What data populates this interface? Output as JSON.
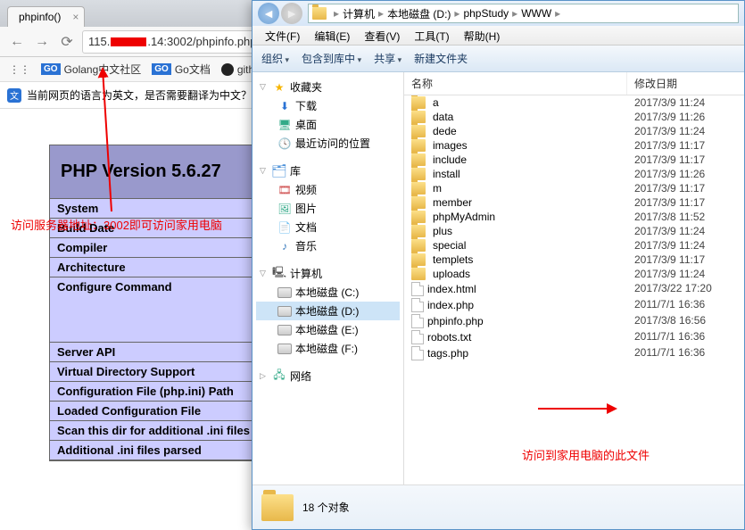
{
  "browser": {
    "tab_title": "phpinfo()",
    "url_pre": "115.",
    "url_post": ".14:3002/phpinfo.php",
    "bookmarks": [
      {
        "badge": "GO",
        "label": "Golang中文社区"
      },
      {
        "badge": "GO",
        "label": "Go文档"
      },
      {
        "icon": "gh",
        "label": "github"
      }
    ],
    "translate_text": "当前网页的语言为英文，是否需要翻译为中文？"
  },
  "php": {
    "title": "PHP Version 5.6.27",
    "rows": [
      "System",
      "Build Date",
      "Compiler",
      "Architecture",
      "Configure Command",
      "Server API",
      "Virtual Directory Support",
      "Configuration File (php.ini) Path",
      "Loaded Configuration File",
      "Scan this dir for additional .ini files",
      "Additional .ini files parsed"
    ]
  },
  "annotation1": "访问服务器地址：3002即可访问家用电脑",
  "annotation2": "访问到家用电脑的此文件",
  "explorer": {
    "breadcrumb": [
      "计算机",
      "本地磁盘 (D:)",
      "phpStudy",
      "WWW"
    ],
    "menus": [
      "文件(F)",
      "编辑(E)",
      "查看(V)",
      "工具(T)",
      "帮助(H)"
    ],
    "toolbar": [
      "组织",
      "包含到库中",
      "共享",
      "新建文件夹"
    ],
    "tree": {
      "fav": {
        "label": "收藏夹",
        "items": [
          "下载",
          "桌面",
          "最近访问的位置"
        ]
      },
      "lib": {
        "label": "库",
        "items": [
          "视频",
          "图片",
          "文档",
          "音乐"
        ]
      },
      "comp": {
        "label": "计算机",
        "items": [
          "本地磁盘 (C:)",
          "本地磁盘 (D:)",
          "本地磁盘 (E:)",
          "本地磁盘 (F:)"
        ]
      },
      "net": {
        "label": "网络"
      }
    },
    "columns": {
      "name": "名称",
      "date": "修改日期"
    },
    "files": [
      {
        "n": "a",
        "t": "folder",
        "d": "2017/3/9 11:24"
      },
      {
        "n": "data",
        "t": "folder",
        "d": "2017/3/9 11:26"
      },
      {
        "n": "dede",
        "t": "folder",
        "d": "2017/3/9 11:24"
      },
      {
        "n": "images",
        "t": "folder",
        "d": "2017/3/9 11:17"
      },
      {
        "n": "include",
        "t": "folder",
        "d": "2017/3/9 11:17"
      },
      {
        "n": "install",
        "t": "folder",
        "d": "2017/3/9 11:26"
      },
      {
        "n": "m",
        "t": "folder",
        "d": "2017/3/9 11:17"
      },
      {
        "n": "member",
        "t": "folder",
        "d": "2017/3/9 11:17"
      },
      {
        "n": "phpMyAdmin",
        "t": "folder",
        "d": "2017/3/8 11:52"
      },
      {
        "n": "plus",
        "t": "folder",
        "d": "2017/3/9 11:24"
      },
      {
        "n": "special",
        "t": "folder",
        "d": "2017/3/9 11:24"
      },
      {
        "n": "templets",
        "t": "folder",
        "d": "2017/3/9 11:17"
      },
      {
        "n": "uploads",
        "t": "folder",
        "d": "2017/3/9 11:24"
      },
      {
        "n": "index.html",
        "t": "file",
        "d": "2017/3/22 17:20"
      },
      {
        "n": "index.php",
        "t": "file",
        "d": "2011/7/1 16:36"
      },
      {
        "n": "phpinfo.php",
        "t": "file",
        "d": "2017/3/8 16:56"
      },
      {
        "n": "robots.txt",
        "t": "file",
        "d": "2011/7/1 16:36"
      },
      {
        "n": "tags.php",
        "t": "file",
        "d": "2011/7/1 16:36"
      }
    ],
    "status": "18 个对象"
  }
}
